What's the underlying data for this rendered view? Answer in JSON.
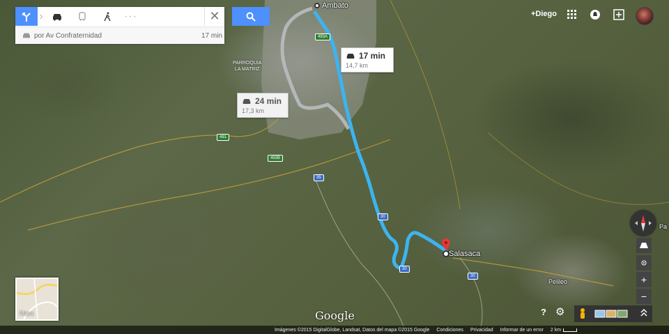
{
  "search_panel": {
    "route_via": "por Av Confraternidad",
    "route_time": "17 min"
  },
  "header": {
    "plus_user": "+Diego"
  },
  "map": {
    "origin": "Ambato",
    "destination": "Salasaca",
    "town_pelileo": "Pelileo",
    "town_edge": "Pa",
    "parish_line1": "PARROQUIA",
    "parish_line2": "LA MATRIZ",
    "shields": [
      "493A",
      "491",
      "493B",
      "35",
      "30",
      "30",
      "30"
    ]
  },
  "routes": {
    "primary": {
      "time": "17 min",
      "distance": "14,7 km"
    },
    "alternate": {
      "time": "24 min",
      "distance": "17,3 km"
    }
  },
  "thumbnail": {
    "label": "Mapa"
  },
  "brand": {
    "logo": "Google"
  },
  "footer": {
    "imagery": "Imágenes ©2015 DigitalGlobe, Landsat, Datos del mapa ©2015 Google",
    "terms": "Condiciones",
    "privacy": "Privacidad",
    "report": "Informar de un error",
    "scale": "2 km"
  },
  "colors": {
    "route_primary": "#3cb4f0",
    "route_alt": "#b9bcbf",
    "active_mode": "#4d90fe"
  }
}
